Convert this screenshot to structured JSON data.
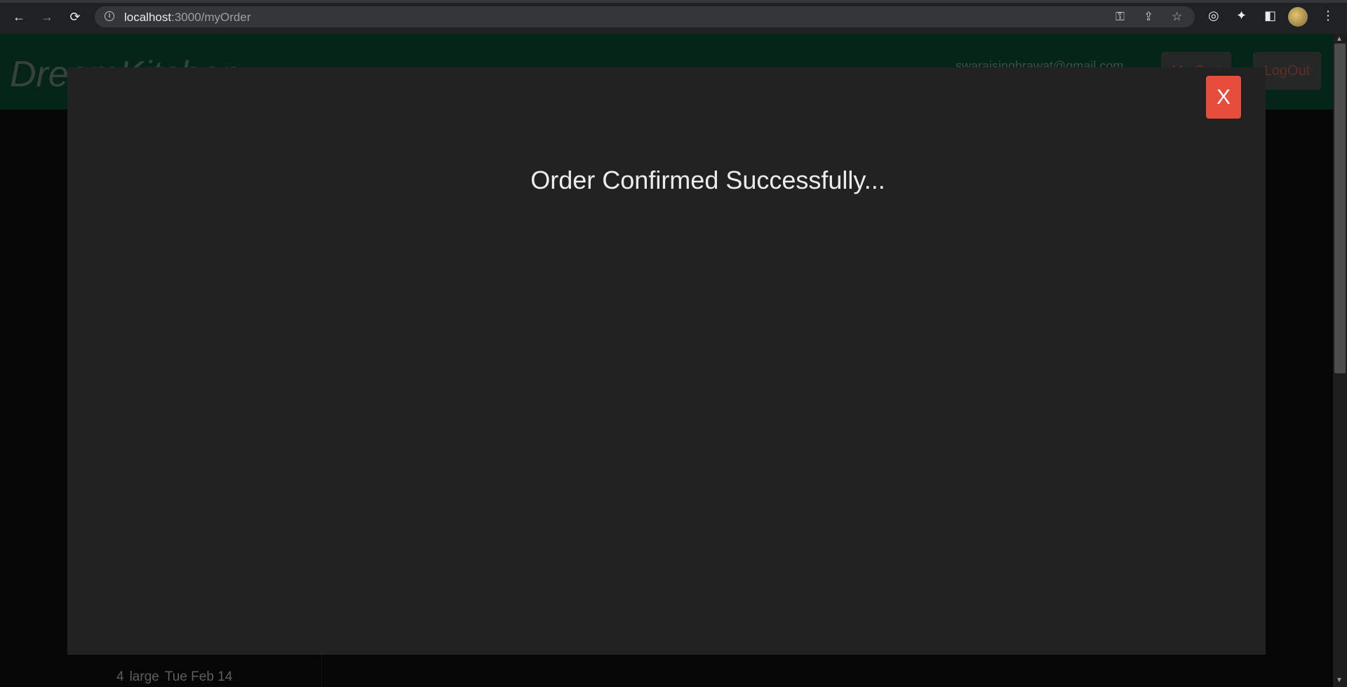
{
  "browser": {
    "url_host": "localhost",
    "url_path": ":3000/myOrder"
  },
  "navbar": {
    "brand": "DreamKitchen",
    "email": "swarajsinghrawat@gmail.com",
    "my_cart_label": "My Cart",
    "logout_label": "LogOut"
  },
  "background_order": {
    "qty": "4",
    "size": "large",
    "date": "Tue Feb 14"
  },
  "modal": {
    "close_label": "X",
    "message": "Order Confirmed Successfully..."
  },
  "colors": {
    "close_button": "#e74c3c",
    "modal_bg": "#222222",
    "navbar_bg": "#0b3f2a"
  }
}
